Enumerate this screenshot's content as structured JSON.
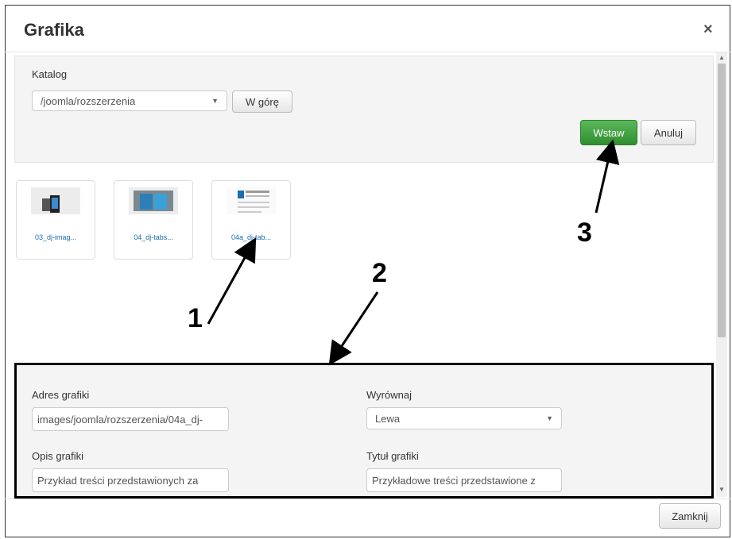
{
  "dialog": {
    "title": "Grafika",
    "close_icon": "×"
  },
  "directory": {
    "label": "Katalog",
    "value": "/joomla/rozszerzenia",
    "up_button": "W górę"
  },
  "actions": {
    "insert_button": "Wstaw",
    "cancel_button": "Anuluj"
  },
  "thumbnails": [
    {
      "name": "03_dj-imag..."
    },
    {
      "name": "04_dj-tabs..."
    },
    {
      "name": "04a_dj-tab..."
    }
  ],
  "fields": {
    "url_label": "Adres grafiki",
    "url_value": "images/joomla/rozszerzenia/04a_dj-",
    "align_label": "Wyrównaj",
    "align_value": "Lewa",
    "desc_label": "Opis grafiki",
    "desc_value": "Przykład treści przedstawionych za",
    "title_label": "Tytuł grafiki",
    "title_value": "Przykładowe treści przedstawione z"
  },
  "footer": {
    "close_button": "Zamknij"
  },
  "annotations": {
    "n1": "1",
    "n2": "2",
    "n3": "3"
  },
  "colors": {
    "success": "#3a9a3a",
    "link": "#1a6fb3"
  }
}
